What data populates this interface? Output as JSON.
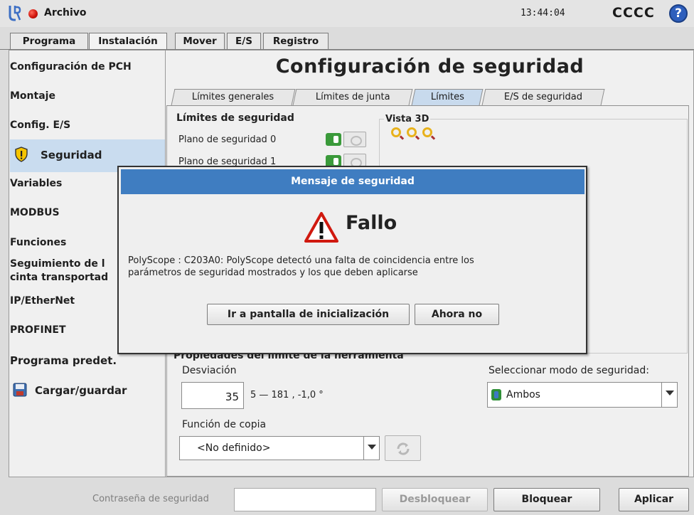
{
  "topbar": {
    "file_menu": "Archivo",
    "time": "13:44:04",
    "robot_name": "CCCC",
    "help": "?"
  },
  "main_tabs": [
    {
      "label": "Programa",
      "active": false
    },
    {
      "label": "Instalación",
      "active": true
    },
    {
      "label": "Mover",
      "active": false
    },
    {
      "label": "E/S",
      "active": false
    },
    {
      "label": "Registro",
      "active": false
    }
  ],
  "sidebar": {
    "items": [
      {
        "label": "Configuración de PCH"
      },
      {
        "label": "Montaje"
      },
      {
        "label": "Config. E/S"
      },
      {
        "label": "Seguridad",
        "selected": true,
        "icon": "shield-warning-icon"
      },
      {
        "label": "Variables"
      },
      {
        "label": "MODBUS"
      },
      {
        "label": "Funciones"
      },
      {
        "label": "Seguimiento de l",
        "label2": "cinta transportad"
      },
      {
        "label": "IP/EtherNet"
      },
      {
        "label": "PROFINET"
      },
      {
        "label": "Programa predet."
      },
      {
        "label": "Cargar/guardar",
        "icon": "save-icon"
      }
    ]
  },
  "main": {
    "title": "Configuración de seguridad",
    "subtabs": [
      {
        "label": "Límites generales",
        "active": false
      },
      {
        "label": "Límites de junta",
        "active": false
      },
      {
        "label": "Límites",
        "active": true
      },
      {
        "label": "E/S de seguridad",
        "active": false
      }
    ],
    "limits_heading": "Límites de seguridad",
    "planes": [
      {
        "label": "Plano de seguridad 0",
        "enabled": true
      },
      {
        "label": "Plano de seguridad 1",
        "enabled": true
      }
    ],
    "view3d_heading": "Vista 3D",
    "zoom_icons": [
      "zoom-in-icon",
      "zoom-fit-icon",
      "zoom-out-icon"
    ],
    "tool_heading": "Propiedades del límite de la herramienta",
    "deviation_label": "Desviación",
    "deviation_value": "35",
    "deviation_range": "5 — 181 , -1,0 °",
    "safety_mode_label": "Seleccionar modo de seguridad:",
    "safety_mode_value": "Ambos",
    "copy_function_label": "Función de copia",
    "copy_function_value": "<No definido>"
  },
  "bottom": {
    "password_label": "Contraseña de seguridad",
    "password_value": "",
    "unlock": "Desbloquear",
    "lock": "Bloquear",
    "apply": "Aplicar"
  },
  "dialog": {
    "title": "Mensaje de seguridad",
    "heading": "Fallo",
    "message_line1": "PolyScope : C203A0: PolyScope detectó una falta de coincidencia entre los",
    "message_line2": "parámetros de seguridad mostrados y los que deben aplicarse",
    "primary_button": "Ir a pantalla de inicialización",
    "secondary_button": "Ahora no"
  },
  "colors": {
    "dialog_title_bg": "#3f7dc1",
    "selected_bg": "#c9dcef",
    "toggle_on": "#3a9a3a",
    "status_red": "#d0160d",
    "help_blue": "#2e5fbd"
  }
}
